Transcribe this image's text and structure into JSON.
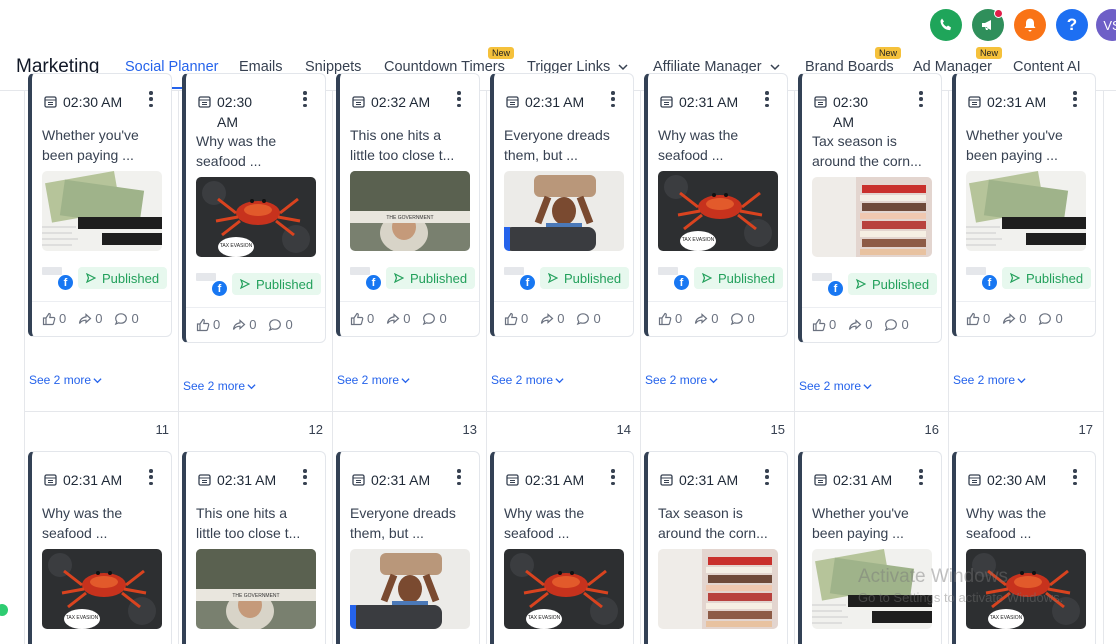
{
  "top_icons": [
    {
      "name": "phone-icon",
      "color": "#1fa55a"
    },
    {
      "name": "megaphone-icon",
      "color": "#2f8f5b",
      "has_dot": true
    },
    {
      "name": "bell-icon",
      "color": "#f97316"
    },
    {
      "name": "help-icon",
      "color": "#1d6ff2"
    }
  ],
  "avatar_initials": "VS",
  "nav": {
    "title": "Marketing",
    "tabs": [
      {
        "label": "Social Planner",
        "active": true
      },
      {
        "label": "Emails"
      },
      {
        "label": "Snippets"
      },
      {
        "label": "Countdown Timers",
        "badge": "New"
      },
      {
        "label": "Trigger Links",
        "dropdown": true
      },
      {
        "label": "Affiliate Manager",
        "dropdown": true
      },
      {
        "label": "Brand Boards",
        "badge": "New"
      },
      {
        "label": "Ad Manager",
        "badge": "New"
      },
      {
        "label": "Content AI"
      }
    ]
  },
  "labels": {
    "published": "Published",
    "see_more": "See 2 more",
    "likes": "0",
    "shares": "0",
    "comments": "0",
    "fb_letter": "f"
  },
  "row1": [
    {
      "time": "02:30 AM",
      "text": [
        "Whether you've",
        "been paying ..."
      ],
      "img": "money"
    },
    {
      "time": "02:30 AM",
      "time_lines": [
        "02:30",
        "AM"
      ],
      "text": [
        "Why was the",
        "seafood ..."
      ],
      "img": "crab"
    },
    {
      "time": "02:32 AM",
      "text": [
        "This one hits a",
        "little too close t..."
      ],
      "img": "wizard"
    },
    {
      "time": "02:31 AM",
      "text": [
        "Everyone dreads",
        "them, but ..."
      ],
      "img": "man"
    },
    {
      "time": "02:31 AM",
      "text": [
        "Why was the",
        "seafood ..."
      ],
      "img": "crab"
    },
    {
      "time": "02:30 AM",
      "time_lines": [
        "02:30",
        "AM"
      ],
      "text": [
        "Tax season is",
        "around the corn..."
      ],
      "img": "files"
    },
    {
      "time": "02:31 AM",
      "text": [
        "Whether you've",
        "been paying ..."
      ],
      "img": "money"
    }
  ],
  "row2_days": [
    "11",
    "12",
    "13",
    "14",
    "15",
    "16",
    "17"
  ],
  "row2": [
    {
      "time": "02:31 AM",
      "text": [
        "Why was the",
        "seafood ..."
      ],
      "img": "crab"
    },
    {
      "time": "02:31 AM",
      "text": [
        "This one hits a",
        "little too close t..."
      ],
      "img": "wizard"
    },
    {
      "time": "02:31 AM",
      "text": [
        "Everyone dreads",
        "them, but ..."
      ],
      "img": "man"
    },
    {
      "time": "02:31 AM",
      "text": [
        "Why was the",
        "seafood ..."
      ],
      "img": "crab"
    },
    {
      "time": "02:31 AM",
      "text": [
        "Tax season is",
        "around the corn..."
      ],
      "img": "files"
    },
    {
      "time": "02:31 AM",
      "text": [
        "Whether you've",
        "been paying ..."
      ],
      "img": "money"
    },
    {
      "time": "02:30 AM",
      "text": [
        "Why was the",
        "seafood ..."
      ],
      "img": "crab"
    }
  ],
  "watermark": {
    "line1": "Activate Windows",
    "line2": "Go to Settings to activate Windows."
  },
  "colors": {
    "accent": "#2563eb",
    "published_bg": "#e7f8ee",
    "published_text": "#22a05b",
    "card_border": "#334155"
  }
}
